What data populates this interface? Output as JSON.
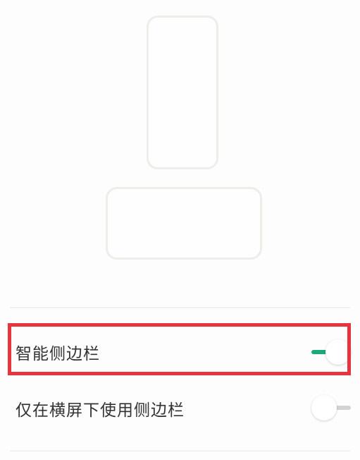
{
  "settings": {
    "items": [
      {
        "label": "智能侧边栏",
        "enabled": true
      },
      {
        "label": "仅在横屏下使用侧边栏",
        "enabled": false
      }
    ]
  },
  "colors": {
    "toggle_on": "#1aaa79",
    "toggle_off": "#d3d3d3",
    "highlight": "#e8343c"
  }
}
